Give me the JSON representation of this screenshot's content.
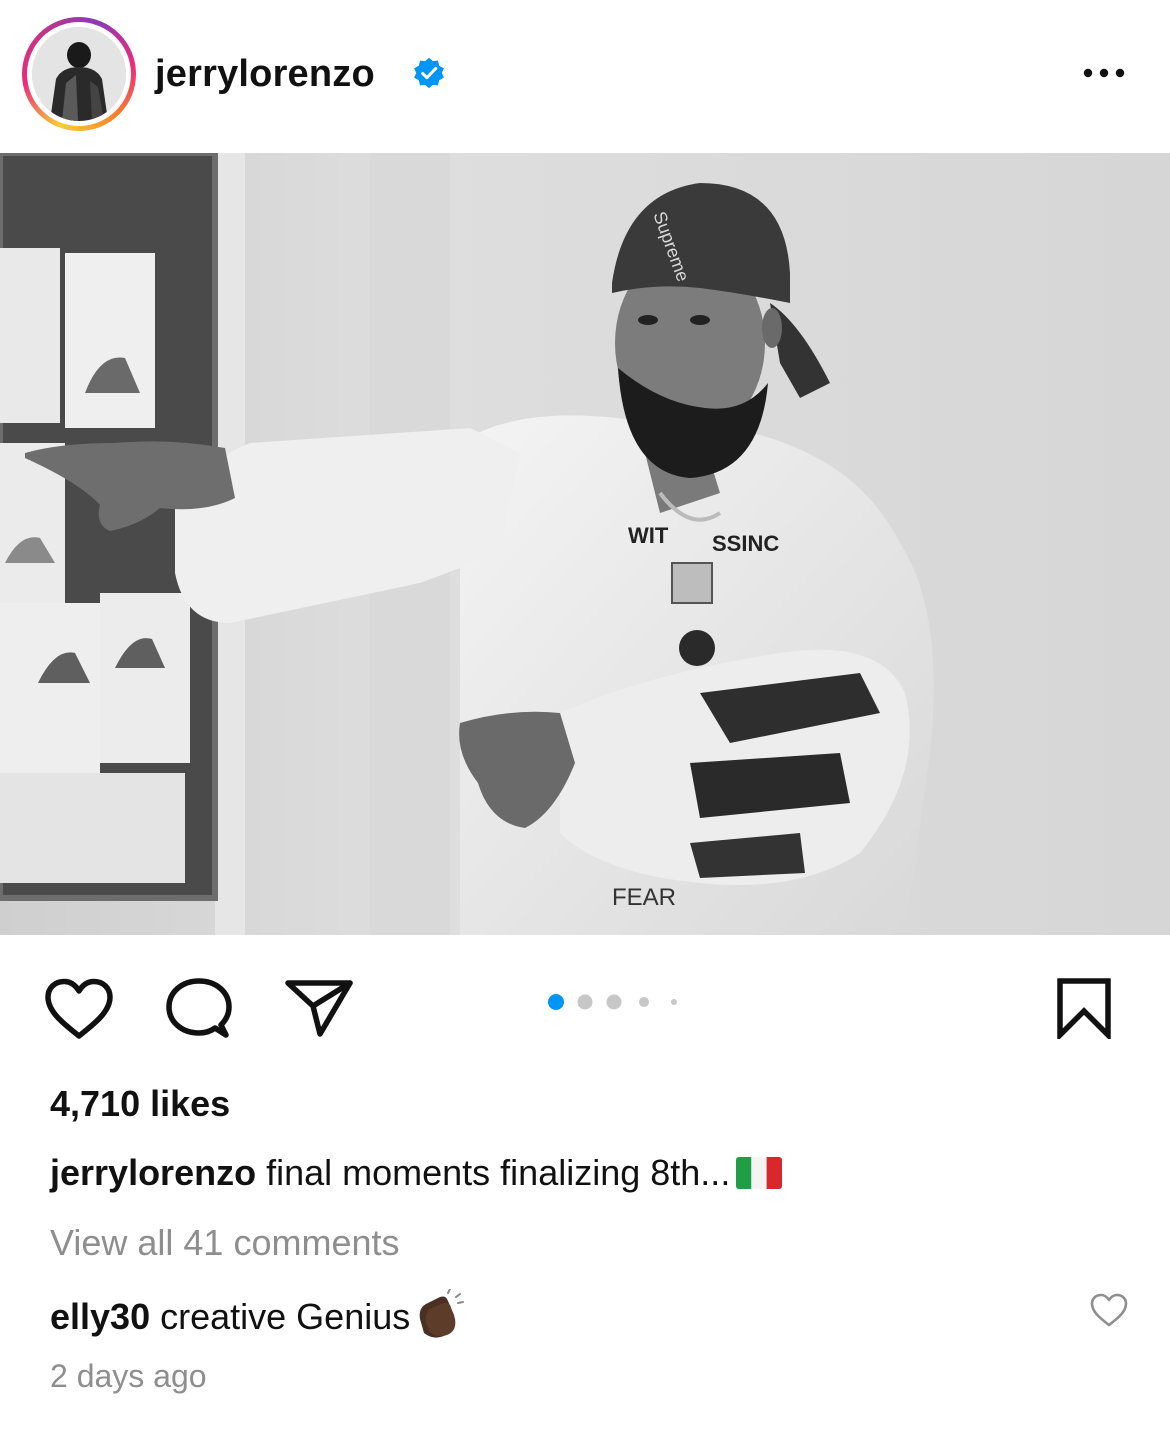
{
  "post": {
    "username": "jerrylorenzo",
    "verified": true,
    "more_icon": "more-horizontal-icon"
  },
  "actions": {
    "like_icon": "heart-icon",
    "comment_icon": "comment-bubble-icon",
    "share_icon": "paper-plane-icon",
    "save_icon": "bookmark-icon",
    "carousel_active_index": 0,
    "carousel_visible_dots": 5
  },
  "likes": "4,710 likes",
  "caption": {
    "username": "jerrylorenzo",
    "text": "final moments finalizing 8th...",
    "emoji": "italy-flag"
  },
  "view_all_comments": "View all 41 comments",
  "top_comment": {
    "username": "elly30",
    "text": "creative Genius",
    "emoji": "clapping-hands"
  },
  "timestamp": "2 days ago",
  "colors": {
    "accent_blue": "#0095f6",
    "muted_text": "#8e8e8e",
    "text": "#111111"
  }
}
